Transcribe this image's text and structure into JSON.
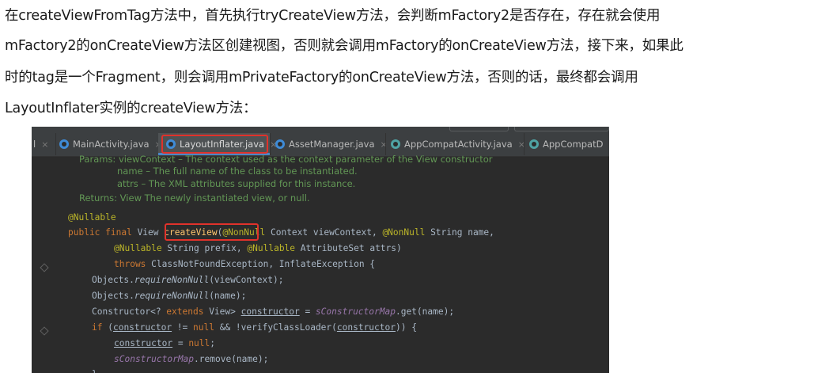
{
  "paragraph": {
    "lines": [
      "在createViewFromTag方法中，首先执行tryCreateView方法，会判断mFactory2是否存在，存在就会使用",
      "mFactory2的onCreateView方法区创建视图，否则就会调用mFactory的onCreateView方法，接下来，如果此",
      "时的tag是一个Fragment，则会调用mPrivateFactory的onCreateView方法，否则的话，最终都会调用",
      "LayoutInflater实例的createView方法："
    ]
  },
  "ide": {
    "tabs": [
      {
        "label": "l",
        "icon": "none"
      },
      {
        "label": "MainActivity.java",
        "icon": "class-icon"
      },
      {
        "label": "LayoutInflater.java",
        "icon": "class-icon",
        "active": true
      },
      {
        "label": "AssetManager.java",
        "icon": "class-icon"
      },
      {
        "label": "AppCompatActivity.java",
        "icon": "class-icon"
      },
      {
        "label": "AppCompatD",
        "icon": "class-icon"
      }
    ],
    "close_glyph": "×",
    "doc": {
      "params_top": "Params:  viewContext – The context used as the context parameter of the View constructor",
      "param_name": "name – The full name of the class to be instantiated.",
      "param_attrs": "attrs – The XML attributes supplied for this instance.",
      "returns": "Returns:  View The newly instantiated view, or null."
    },
    "code": {
      "annotation_nullable": "@Nullable",
      "l2_public": "public final ",
      "l2_view": "View ",
      "l2_method": "createView",
      "l2_paren": "(",
      "l2_ann1": "@NonNull",
      "l2_rest": " Context viewContext, ",
      "l2_ann2": "@NonNull",
      "l2_rest2": " String name,",
      "l3_ann": "@Nullable",
      "l3_rest": " String prefix, ",
      "l3_ann2": "@Nullable",
      "l3_rest2": " AttributeSet attrs)",
      "l4_kw": "throws",
      "l4_rest": " ClassNotFoundException, InflateException {",
      "l5_a": "Objects.",
      "l5_b": "requireNonNull",
      "l5_c": "(viewContext);",
      "l6_a": "Objects.",
      "l6_b": "requireNonNull",
      "l6_c": "(name);",
      "l7_a": "Constructor<? ",
      "l7_kw": "extends",
      "l7_b": " View> ",
      "l7_var": "constructor",
      "l7_c": " = ",
      "l7_static": "sConstructorMap",
      "l7_d": ".get(name);",
      "l8_kw": "if",
      "l8_a": " (",
      "l8_var": "constructor",
      "l8_b": " != ",
      "l8_null": "null",
      "l8_c": " && !verifyClassLoader(",
      "l8_var2": "constructor",
      "l8_d": ")) {",
      "l9_var": "constructor",
      "l9_a": " = ",
      "l9_null": "null",
      "l9_b": ";",
      "l10_static": "sConstructorMap",
      "l10_a": ".remove(name);",
      "l11": "}"
    }
  },
  "colors": {
    "accent_tab_underline": "#4a88c7",
    "highlight_box": "#e0322b",
    "editor_bg": "#2b2b2b"
  }
}
